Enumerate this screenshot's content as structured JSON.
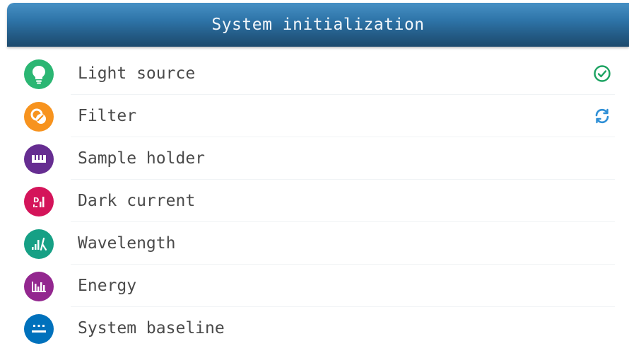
{
  "header": {
    "title": "System initialization"
  },
  "items": [
    {
      "label": "Light source",
      "icon": "lightbulb-icon",
      "color": "#2bb673",
      "status": "done"
    },
    {
      "label": "Filter",
      "icon": "filter-icon",
      "color": "#f7931e",
      "status": "in-progress"
    },
    {
      "label": "Sample holder",
      "icon": "sample-holder-icon",
      "color": "#662d91",
      "status": ""
    },
    {
      "label": "Dark current",
      "icon": "dark-current-icon",
      "color": "#d4145a",
      "status": ""
    },
    {
      "label": "Wavelength",
      "icon": "wavelength-icon",
      "color": "#16a085",
      "status": ""
    },
    {
      "label": "Energy",
      "icon": "energy-icon",
      "color": "#93278f",
      "status": ""
    },
    {
      "label": "System baseline",
      "icon": "baseline-icon",
      "color": "#0071bc",
      "status": ""
    }
  ],
  "colors": {
    "done": "#1aa260",
    "in_progress": "#2e8fd6"
  }
}
